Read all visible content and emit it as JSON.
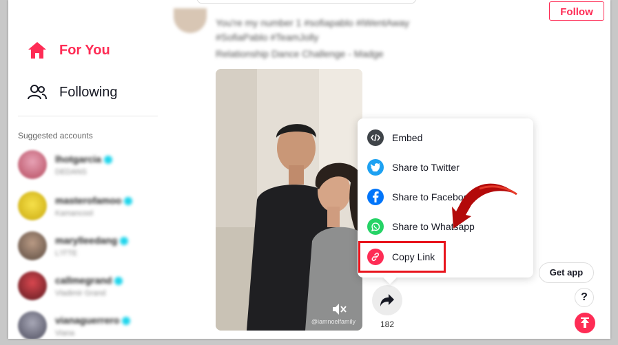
{
  "nav": {
    "for_you": "For You",
    "following": "Following"
  },
  "follow_button": "Follow",
  "suggested": {
    "title": "Suggested accounts",
    "accounts": [
      {
        "name": "lhotgarcia",
        "sub": "DEDANS"
      },
      {
        "name": "masterofamoo",
        "sub": "Kamancool"
      },
      {
        "name": "marylleedang",
        "sub": "L'ITTE"
      },
      {
        "name": "callmegrand",
        "sub": "Vladimir Grand"
      },
      {
        "name": "vianaguerrero",
        "sub": "Viana"
      }
    ]
  },
  "post": {
    "caption": "You're my number 1 #sofiapablo #iWentAway",
    "hashtags": "#SofiaPablo #TeamJolly",
    "sound": "Relationship Dance Challenge - Madge",
    "share_count": "182",
    "watermark": "@iamnoelfamily"
  },
  "share_menu": {
    "items": [
      {
        "label": "Embed",
        "icon": "embed-icon",
        "color": "#3f4449"
      },
      {
        "label": "Share to Twitter",
        "icon": "twitter-icon",
        "color": "#1da1f2"
      },
      {
        "label": "Share to Facebook",
        "icon": "facebook-icon",
        "color": "#0075fa"
      },
      {
        "label": "Share to Whatsapp",
        "icon": "whatsapp-icon",
        "color": "#25d366"
      },
      {
        "label": "Copy Link",
        "icon": "link-icon",
        "color": "#fe2c55"
      }
    ]
  },
  "buttons": {
    "get_app": "Get app",
    "help": "?"
  },
  "colors": {
    "accent": "#fe2c55",
    "highlight": "#e8141d"
  }
}
